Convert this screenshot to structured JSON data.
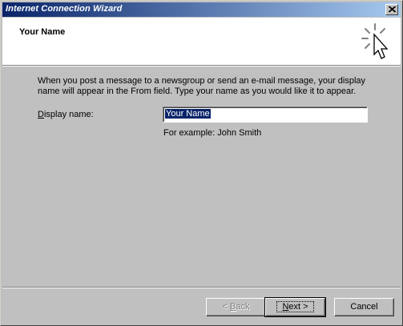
{
  "window": {
    "title": "Internet Connection Wizard"
  },
  "header": {
    "title": "Your Name"
  },
  "body": {
    "description": "When you post a message to a newsgroup or send an e-mail message, your display name will appear in the From field.  Type your name as you would like it to appear.",
    "display_name_label_mnemonic": "D",
    "display_name_label_rest": "isplay name:",
    "display_name_value": "Your Name",
    "example": "For example: John Smith"
  },
  "buttons": {
    "back_prefix": "< ",
    "back_mnemonic": "B",
    "back_rest": "ack",
    "next_mnemonic": "N",
    "next_rest": "ext >",
    "cancel": "Cancel"
  }
}
